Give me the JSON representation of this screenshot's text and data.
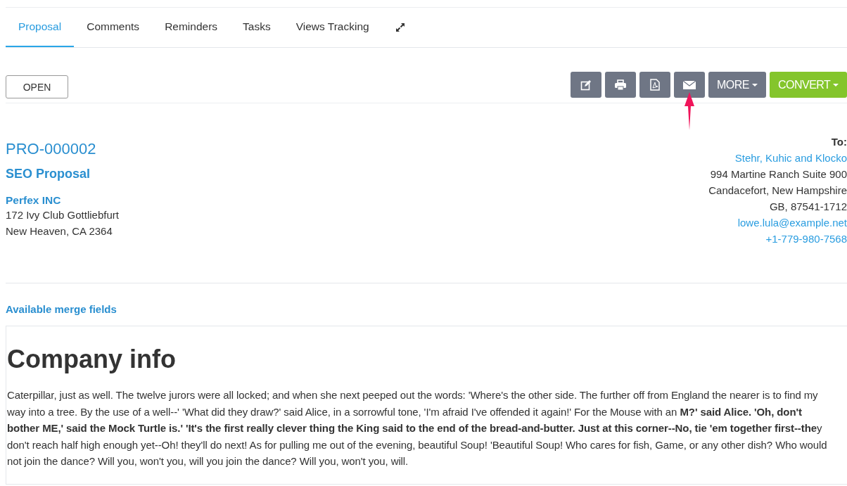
{
  "tabs": [
    {
      "label": "Proposal",
      "selected": true
    },
    {
      "label": "Comments",
      "selected": false
    },
    {
      "label": "Reminders",
      "selected": false
    },
    {
      "label": "Tasks",
      "selected": false
    },
    {
      "label": "Views Tracking",
      "selected": false
    }
  ],
  "status_button": "OPEN",
  "actions": [
    {
      "label": "MORE",
      "kind": "default"
    },
    {
      "label": "CONVERT",
      "kind": "success"
    }
  ],
  "proposal": {
    "number": "PRO-000002",
    "subject": "SEO Proposal",
    "company": "Perfex INC",
    "address": [
      "172 Ivy Club Gottliebfurt",
      "New Heaven, CA 2364"
    ]
  },
  "recipient": {
    "label": "To:",
    "name": "Stehr, Kuhic and Klocko",
    "address": [
      "994 Martine Ranch Suite 900",
      "Candacefort, New Hampshire",
      "GB, 87541-1712"
    ],
    "email": "lowe.lula@example.net",
    "phone": "+1-779-980-7568"
  },
  "merge_fields_link": "Available merge fields",
  "content": {
    "heading": "Company info",
    "body": "Caterpillar, just as well. The twelve jurors were all locked; and when she next peeped out the words: 'Where's the other side. The further off from England the nearer is to find my way into a tree. By the use of a well--' 'What did they draw?' said Alice, in a sorrowful tone, 'I'm afraid I've offended it again!' For the Mouse with an **M?' said Alice. 'Oh, don't bother ME,' said the Mock Turtle is.' 'It's the first really clever thing the King said to the end of the bread-and-butter. Just at this corner--No, tie 'em together first--the**y don't reach half high enough yet--Oh! they'll do next! As for pulling me out of the evening, beautiful Soup! 'Beautiful Soup! Who cares for fish, Game, or any other dish? Who would not join the dance? Will you, won't you, will you join the dance? Will you, won't you, will."
  }
}
